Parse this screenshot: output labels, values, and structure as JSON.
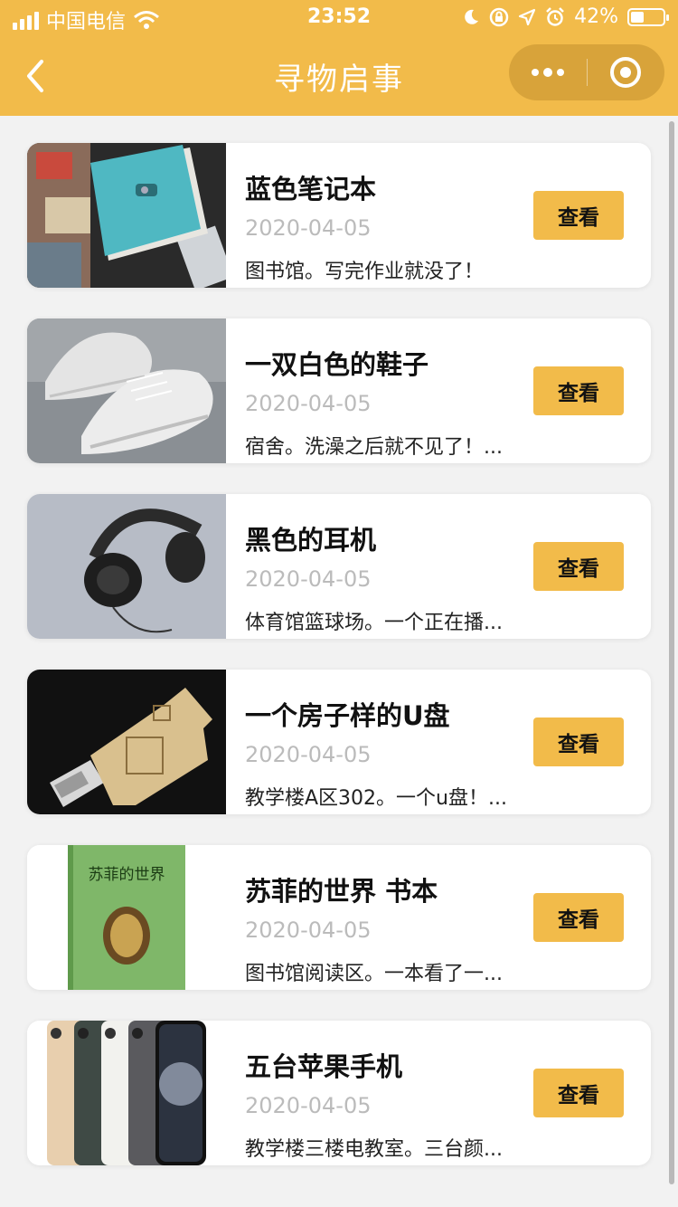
{
  "status_bar": {
    "carrier": "中国电信",
    "time": "23:52",
    "battery_text": "42%",
    "battery_level": 0.42,
    "icons": [
      "signal-icon",
      "wifi-icon",
      "moon-icon",
      "rotation-lock-icon",
      "location-icon",
      "alarm-icon",
      "battery-icon"
    ]
  },
  "navbar": {
    "title": "寻物启事",
    "back_icon": "chevron-left-icon",
    "more_icon": "more-dots-icon",
    "close_icon": "target-circle-icon"
  },
  "colors": {
    "accent": "#f2bb4a",
    "background": "#f2f2f2",
    "card": "#ffffff",
    "date_text": "#bbbbbb"
  },
  "items": [
    {
      "name": "蓝色笔记本",
      "date": "2020-04-05",
      "desc": "图书馆。写完作业就没了！",
      "button": "查看",
      "image": "notebook-image"
    },
    {
      "name": "一双白色的鞋子",
      "date": "2020-04-05",
      "desc": "宿舍。洗澡之后就不见了！...",
      "button": "查看",
      "image": "sneakers-image"
    },
    {
      "name": "黑色的耳机",
      "date": "2020-04-05",
      "desc": "体育馆篮球场。一个正在播...",
      "button": "查看",
      "image": "headphones-image"
    },
    {
      "name": "一个房子样的U盘",
      "date": "2020-04-05",
      "desc": "教学楼A区302。一个u盘！...",
      "button": "查看",
      "image": "usb-drive-image"
    },
    {
      "name": "苏菲的世界 书本",
      "date": "2020-04-05",
      "desc": "图书馆阅读区。一本看了一...",
      "button": "查看",
      "image": "book-image",
      "book_title": "苏菲的世界"
    },
    {
      "name": "五台苹果手机",
      "date": "2020-04-05",
      "desc": "教学楼三楼电教室。三台颜...",
      "button": "查看",
      "image": "phones-image"
    }
  ]
}
